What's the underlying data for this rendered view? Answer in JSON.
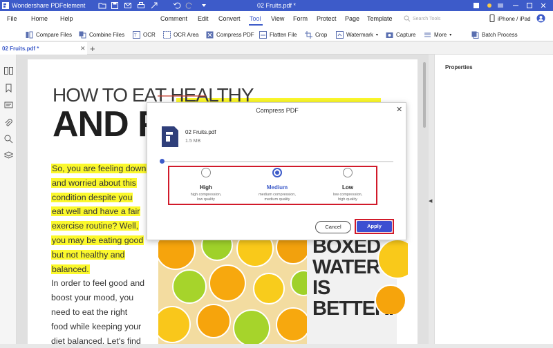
{
  "titlebar": {
    "app_title": "Wondershare PDFelement",
    "doc_title": "02 Fruits.pdf *"
  },
  "menu": {
    "items": [
      "File",
      "Home",
      "Help",
      "Comment",
      "Edit",
      "Convert",
      "Tool",
      "View",
      "Form",
      "Protect",
      "Page",
      "Template"
    ],
    "active": "Tool",
    "search_placeholder": "Search Tools",
    "device_label": "iPhone / iPad"
  },
  "toolbar": {
    "items": [
      "Compare Files",
      "Combine Files",
      "OCR",
      "OCR Area",
      "Compress PDF",
      "Flatten File",
      "Crop",
      "Watermark",
      "Capture",
      "More",
      "Batch Process"
    ]
  },
  "tabs": {
    "doc_tab": "02 Fruits.pdf *",
    "add": "+"
  },
  "properties_panel": {
    "title": "Properties"
  },
  "document": {
    "headline_line1": "HOW TO EAT HEALTHY",
    "headline_line2": "AND FEE",
    "highlighted_lines": [
      "So, you are feeling down",
      "and worried about this",
      "condition despite you",
      "eat well and have a fair",
      "exercise routine? Well,",
      "you may be eating good",
      "but not healthy and",
      "balanced."
    ],
    "plain_lines": [
      "In order to feel good and",
      "boost your mood, you",
      "need to eat the right",
      "food while keeping your",
      "diet balanced. Let's find"
    ],
    "boxed_text": [
      "BOXED",
      "WATER",
      "IS",
      "BETTER."
    ]
  },
  "dialog": {
    "title": "Compress PDF",
    "file_name": "02 Fruits.pdf",
    "file_size": "1.5 MB",
    "options": [
      {
        "label": "High",
        "desc1": "high compression,",
        "desc2": "low quality",
        "selected": false
      },
      {
        "label": "Medium",
        "desc1": "medium compression,",
        "desc2": "medium quality",
        "selected": true
      },
      {
        "label": "Low",
        "desc1": "low compression,",
        "desc2": "high quality",
        "selected": false
      }
    ],
    "cancel": "Cancel",
    "apply": "Apply"
  },
  "colors": {
    "accent": "#3d5bc9",
    "highlight": "#fbf82c",
    "callout_red": "#d11a2a"
  }
}
